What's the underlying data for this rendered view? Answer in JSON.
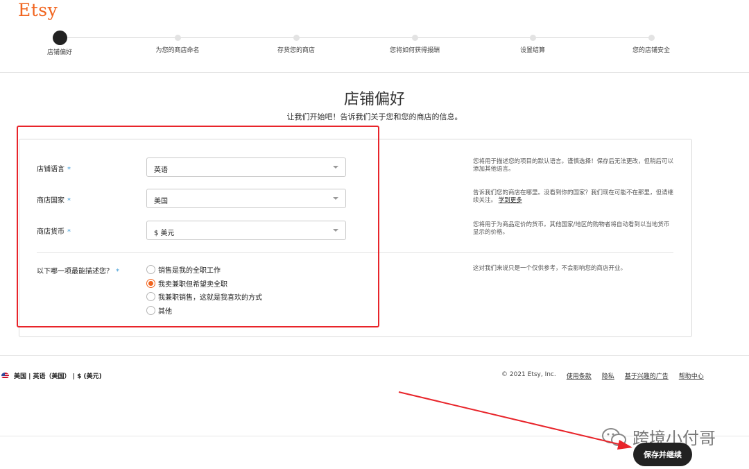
{
  "brand": {
    "logo": "Etsy",
    "accent": "#f1641e"
  },
  "steps": [
    {
      "label": "店铺偏好",
      "active": true
    },
    {
      "label": "为您的商店命名",
      "active": false
    },
    {
      "label": "存货您的商店",
      "active": false
    },
    {
      "label": "您将如何获得报酬",
      "active": false
    },
    {
      "label": "设置结算",
      "active": false
    },
    {
      "label": "您的店铺安全",
      "active": false
    }
  ],
  "page": {
    "title": "店铺偏好",
    "subtitle": "让我们开始吧！告诉我们关于您和您的商店的信息。"
  },
  "form": {
    "language": {
      "label": "店铺语言",
      "value": "英语",
      "help": "您将用于描述您的项目的默认语言。谨慎选择！保存后无法更改，但稍后可以添加其他语言。"
    },
    "country": {
      "label": "商店国家",
      "value": "美国",
      "help": "告诉我们您的商店在哪里。没看到你的国家？我们现在可能不在那里，但请继续关注。",
      "help_link": "学到更多"
    },
    "currency": {
      "label": "商店货币",
      "value": "$ 美元",
      "help": "您将用于为商品定价的货币。其他国家/地区的购物者将自动看到以当地货币显示的价格。"
    },
    "describe": {
      "label": "以下哪一项最能描述您？",
      "help": "这对我们来说只是一个仅供参考，不会影响您的商店开业。",
      "options": [
        {
          "label": "销售是我的全职工作",
          "checked": false
        },
        {
          "label": "我卖兼职但希望卖全职",
          "checked": true
        },
        {
          "label": "我兼职销售，这就是我喜欢的方式",
          "checked": false
        },
        {
          "label": "其他",
          "checked": false
        }
      ]
    },
    "required_mark": "*"
  },
  "footer": {
    "locale": "美国 | 英语（美国） | $ (美元)",
    "copyright": "© 2021 Etsy, Inc.",
    "links": [
      "使用条款",
      "隐私",
      "基于兴趣的广告",
      "帮助中心"
    ]
  },
  "save_button": "保存并继续",
  "watermark": "跨境小付哥"
}
